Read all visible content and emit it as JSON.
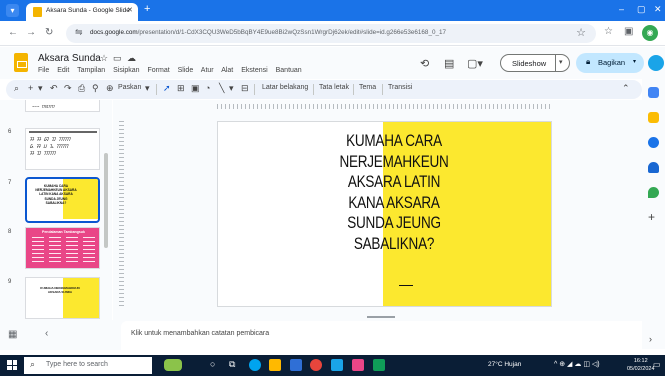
{
  "browser": {
    "tab_title": "Aksara Sunda - Google Slide",
    "url_domain": "docs.google.com",
    "url_path": "/presentation/d/1-CdX3CQU3WeD5bBqBY4E9ue8Bi2wQzSsn1WrgrDj62ek/edit#slide=id.g266e53e6168_0_17"
  },
  "app": {
    "title": "Aksara Sunda",
    "menu": [
      "File",
      "Edit",
      "Tampilan",
      "Sisipkan",
      "Format",
      "Slide",
      "Atur",
      "Alat",
      "Ekstensi",
      "Bantuan"
    ],
    "slideshow_label": "Slideshow",
    "share_label": "Bagikan"
  },
  "toolbar": {
    "zoom_label": "Paskan",
    "background_label": "Latar belakang",
    "layout_label": "Tata letak",
    "theme_label": "Tema",
    "transition_label": "Transisi"
  },
  "filmstrip": {
    "slide_numbers": [
      "6",
      "7",
      "8",
      "9"
    ],
    "thumb7_text": "KUMAHA CARA NERJEMAHKEUN AKSARA LATIN KANA AKSARA SUNDA JEUNG SABALIKNA?",
    "thumb8_title": "Pendalaman Tambangsuk",
    "thumb9_text": "KUMAHA NERJEMAHKEUN AKSARA SUNDA"
  },
  "slide": {
    "title_lines": [
      "KUMAHA CARA",
      "NERJEMAHKEUN",
      "AKSARA LATIN",
      "KANA AKSARA",
      "SUNDA JEUNG",
      "SABALIKNA?"
    ],
    "accent_color": "#fce82f"
  },
  "notes": {
    "placeholder": "Klik untuk menambahkan catatan pembicara"
  },
  "taskbar": {
    "search_placeholder": "Type here to search",
    "weather": "27°C Hujan",
    "time": "16:12",
    "date": "05/02/2024"
  },
  "icons": [
    "search-icon",
    "back-icon",
    "forward-icon",
    "reload-icon",
    "star-icon",
    "history-icon",
    "comment-icon",
    "camera-icon",
    "lock-icon",
    "grid-icon"
  ]
}
